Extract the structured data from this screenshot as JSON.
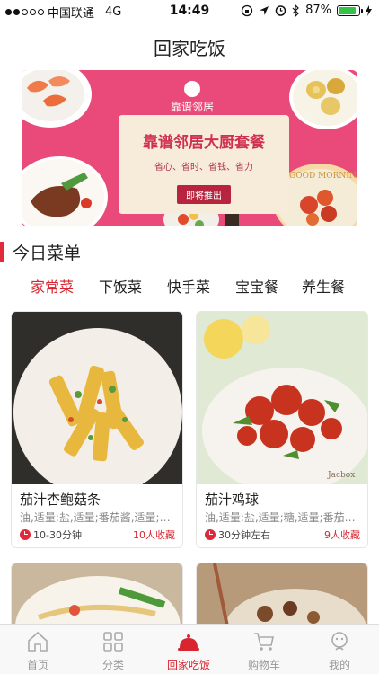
{
  "status_bar": {
    "carrier": "中国联通",
    "network": "4G",
    "time": "14:49",
    "battery": "87%",
    "battery_level": 0.87,
    "signal_bars_filled": 2,
    "signal_bars_total": 5
  },
  "nav": {
    "title": "回家吃饭"
  },
  "banner": {
    "brand": "靠谱邻居",
    "headline": "靠谱邻居大厨套餐",
    "subline": "省心、省时、省钱、省力",
    "cta": "即将推出",
    "corner_text": "GOOD MORNING"
  },
  "section": {
    "title": "今日菜单",
    "accent_color": "#e12b3b"
  },
  "tabs": [
    {
      "label": "家常菜",
      "active": true
    },
    {
      "label": "下饭菜",
      "active": false
    },
    {
      "label": "快手菜",
      "active": false
    },
    {
      "label": "宝宝餐",
      "active": false
    },
    {
      "label": "养生餐",
      "active": false
    }
  ],
  "recipes": [
    {
      "name": "茄汁杏鲍菇条",
      "ingredients": "油,适量;盐,适量;番茄酱,适量;生抽,适量",
      "time": "10-30分钟",
      "favorites": "10人收藏",
      "photo_icon": "stir-fried-king-oyster-mushroom-photo"
    },
    {
      "name": "茄汁鸡球",
      "ingredients": "油,适量;盐,适量;糖,适量;番茄酱,适量",
      "time": "30分钟左右",
      "favorites": "9人收藏",
      "photo_icon": "tomato-chicken-balls-photo",
      "watermark": "Jacbox"
    }
  ],
  "tab_bar": {
    "items": [
      {
        "label": "首页",
        "icon": "home-icon",
        "active": false
      },
      {
        "label": "分类",
        "icon": "grid-icon",
        "active": false
      },
      {
        "label": "回家吃饭",
        "icon": "cloche-icon",
        "active": true
      },
      {
        "label": "购物车",
        "icon": "cart-icon",
        "active": false
      },
      {
        "label": "我的",
        "icon": "profile-icon",
        "active": false
      }
    ]
  },
  "colors": {
    "brand_red": "#d8252f",
    "banner_pink": "#e94a7a",
    "battery_green": "#35c24a"
  }
}
